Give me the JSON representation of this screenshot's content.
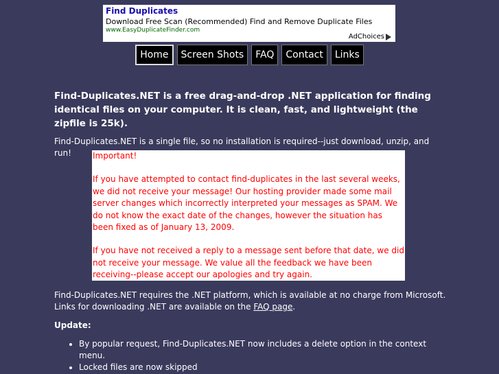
{
  "ad": {
    "title": "Find Duplicates",
    "description": "Download Free Scan (Recommended) Find and Remove Duplicate Files",
    "url": "www.EasyDuplicateFinder.com",
    "choices_label": "AdChoices"
  },
  "nav": {
    "items": [
      {
        "label": "Home",
        "active": true
      },
      {
        "label": "Screen Shots"
      },
      {
        "label": "FAQ"
      },
      {
        "label": "Contact"
      },
      {
        "label": "Links"
      }
    ]
  },
  "main": {
    "lead": "Find-Duplicates.NET is a free drag-and-drop .NET application for finding identical files on your computer. It is clean, fast, and lightweight (the zipfile is 25k).",
    "single_file": "Find-Duplicates.NET is a single file, so no installation is required--just download, unzip, and run!",
    "notice": {
      "heading": "Important!",
      "para1": "If you have attempted to contact find-duplicates in the last several weeks, we did not receive your message! Our hosting provider made some mail server changes which incorrectly interpreted your messages as SPAM. We do not know the exact date of the changes, however the situation has been fixed as of January 13, 2009.",
      "para2": "If you have not received a reply to a message sent before that date, we did not receive your message. We value all the feedback we have been receiving--please accept our apologies and try again."
    },
    "requirements_text": "Find-Duplicates.NET requires the .NET platform, which is available at no charge from Microsoft. Links for downloading .NET are available on the ",
    "faq_link": "FAQ page",
    "requirements_end": ".",
    "update_heading": "Update:",
    "updates": [
      "By popular request, Find-Duplicates.NET now includes a delete option in the context menu.",
      "Locked files are now skipped"
    ]
  }
}
